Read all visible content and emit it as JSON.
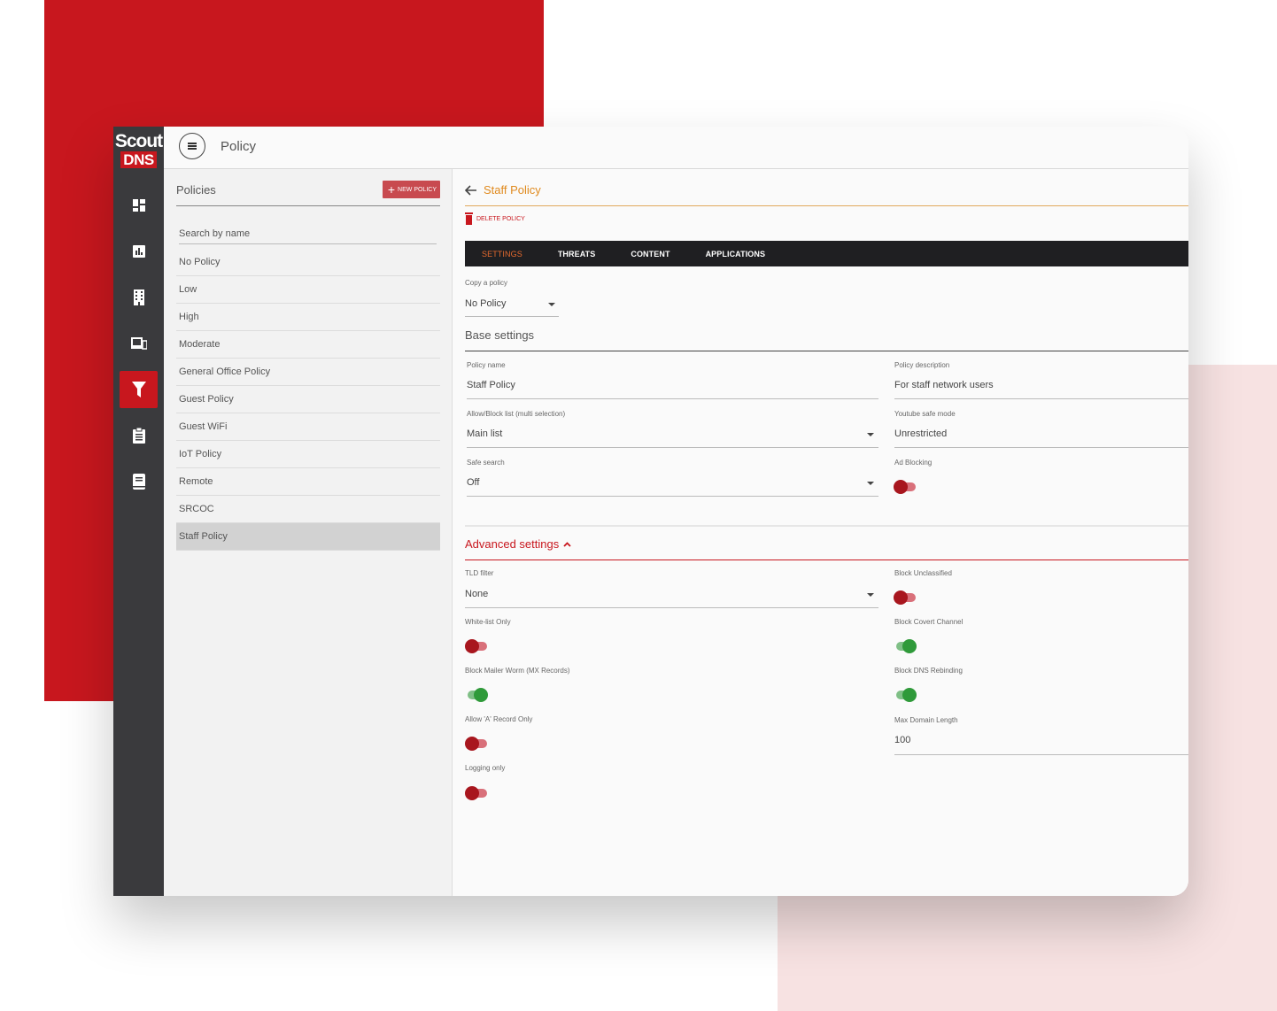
{
  "brand": {
    "logo_line1": "Scout",
    "logo_line2": "DNS",
    "accent": "#c8171e"
  },
  "topbar": {
    "title": "Policy"
  },
  "rail": {
    "items": [
      {
        "icon": "dashboard-icon"
      },
      {
        "icon": "reports-icon"
      },
      {
        "icon": "building-icon"
      },
      {
        "icon": "devices-icon"
      },
      {
        "icon": "filter-icon",
        "active": true
      },
      {
        "icon": "clipboard-icon"
      },
      {
        "icon": "book-icon"
      }
    ]
  },
  "list": {
    "title": "Policies",
    "new_button": "NEW POLICY",
    "search_placeholder": "Search by name",
    "items": [
      "No Policy",
      "Low",
      "High",
      "Moderate",
      "General Office Policy",
      "Guest Policy",
      "Guest WiFi",
      "IoT Policy",
      "Remote",
      "SRCOC",
      "Staff Policy"
    ],
    "selected": "Staff Policy"
  },
  "detail": {
    "title": "Staff Policy",
    "delete_label": "DELETE POLICY",
    "tabs": [
      "SETTINGS",
      "THREATS",
      "CONTENT",
      "APPLICATIONS"
    ],
    "active_tab": "SETTINGS",
    "copy_policy": {
      "label": "Copy a policy",
      "value": "No Policy"
    },
    "base": {
      "title": "Base settings",
      "policy_name": {
        "label": "Policy name",
        "value": "Staff Policy"
      },
      "policy_description": {
        "label": "Policy description",
        "value": "For staff network users"
      },
      "allow_block": {
        "label": "Allow/Block list (multi selection)",
        "value": "Main list"
      },
      "youtube": {
        "label": "Youtube safe mode",
        "value": "Unrestricted"
      },
      "safe_search": {
        "label": "Safe search",
        "value": "Off"
      },
      "ad_blocking": {
        "label": "Ad Blocking",
        "on": false
      }
    },
    "advanced": {
      "title": "Advanced settings",
      "tld_filter": {
        "label": "TLD filter",
        "value": "None"
      },
      "whitelist_only": {
        "label": "White-list Only",
        "on": false
      },
      "block_mailer_worm": {
        "label": "Block Mailer Worm (MX Records)",
        "on": true
      },
      "allow_a_record": {
        "label": "Allow 'A' Record Only",
        "on": false
      },
      "logging_only": {
        "label": "Logging only",
        "on": false
      },
      "block_unclassified": {
        "label": "Block Unclassified",
        "on": false
      },
      "block_covert": {
        "label": "Block Covert Channel",
        "on": true
      },
      "block_dns_rebinding": {
        "label": "Block DNS Rebinding",
        "on": true
      },
      "max_domain_length": {
        "label": "Max Domain Length",
        "value": "100"
      }
    }
  }
}
